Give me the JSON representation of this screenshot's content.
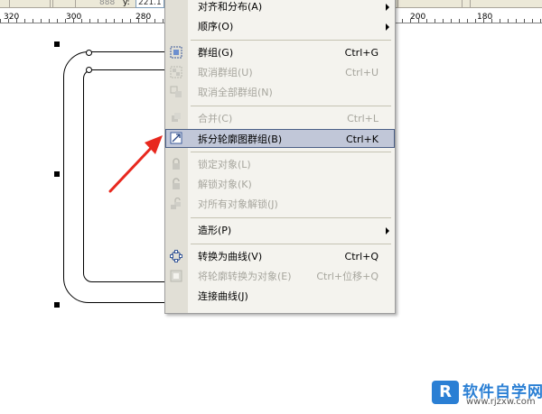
{
  "property_bar": {
    "y_label": "y:",
    "y_value": "221.1",
    "obscured_field": "888"
  },
  "ruler": {
    "labels_left": [
      "320",
      "300",
      "280"
    ],
    "labels_right": [
      "200",
      "180"
    ]
  },
  "context_menu": {
    "items": [
      {
        "label": "对齐和分布(A)",
        "shortcut": "",
        "submenu": true,
        "disabled": false,
        "icon": "none"
      },
      {
        "label": "顺序(O)",
        "shortcut": "",
        "submenu": true,
        "disabled": false,
        "icon": "none"
      },
      {
        "label": "群组(G)",
        "shortcut": "Ctrl+G",
        "submenu": false,
        "disabled": false,
        "icon": "group-icon"
      },
      {
        "label": "取消群组(U)",
        "shortcut": "Ctrl+U",
        "submenu": false,
        "disabled": true,
        "icon": "ungroup-icon"
      },
      {
        "label": "取消全部群组(N)",
        "shortcut": "",
        "submenu": false,
        "disabled": true,
        "icon": "ungroup-all-icon"
      },
      {
        "label": "合并(C)",
        "shortcut": "Ctrl+L",
        "submenu": false,
        "disabled": true,
        "icon": "combine-icon"
      },
      {
        "label": "拆分轮廓图群组(B)",
        "shortcut": "Ctrl+K",
        "submenu": false,
        "disabled": false,
        "highlighted": true,
        "icon": "break-apart-icon"
      },
      {
        "label": "锁定对象(L)",
        "shortcut": "",
        "submenu": false,
        "disabled": true,
        "icon": "lock-icon"
      },
      {
        "label": "解锁对象(K)",
        "shortcut": "",
        "submenu": false,
        "disabled": true,
        "icon": "unlock-icon"
      },
      {
        "label": "对所有对象解锁(J)",
        "shortcut": "",
        "submenu": false,
        "disabled": true,
        "icon": "unlock-all-icon"
      },
      {
        "label": "造形(P)",
        "shortcut": "",
        "submenu": true,
        "disabled": false,
        "icon": "none"
      },
      {
        "label": "转换为曲线(V)",
        "shortcut": "Ctrl+Q",
        "submenu": false,
        "disabled": false,
        "icon": "convert-to-curves-icon"
      },
      {
        "label": "将轮廓转换为对象(E)",
        "shortcut": "Ctrl+位移+Q",
        "submenu": false,
        "disabled": true,
        "icon": "outline-to-object-icon"
      },
      {
        "label": "连接曲线(J)",
        "shortcut": "",
        "submenu": false,
        "disabled": false,
        "icon": "none"
      }
    ]
  },
  "watermark": {
    "title": "软件自学网",
    "url": "www.rjzxw.com"
  },
  "colors": {
    "menu_bg": "#f4f3ee",
    "gutter": "#e1dfd6",
    "highlight": "#c1c7d8",
    "highlight_border": "#4a5f86",
    "arrow": "#e8281e",
    "brand": "#2a7fd4"
  }
}
